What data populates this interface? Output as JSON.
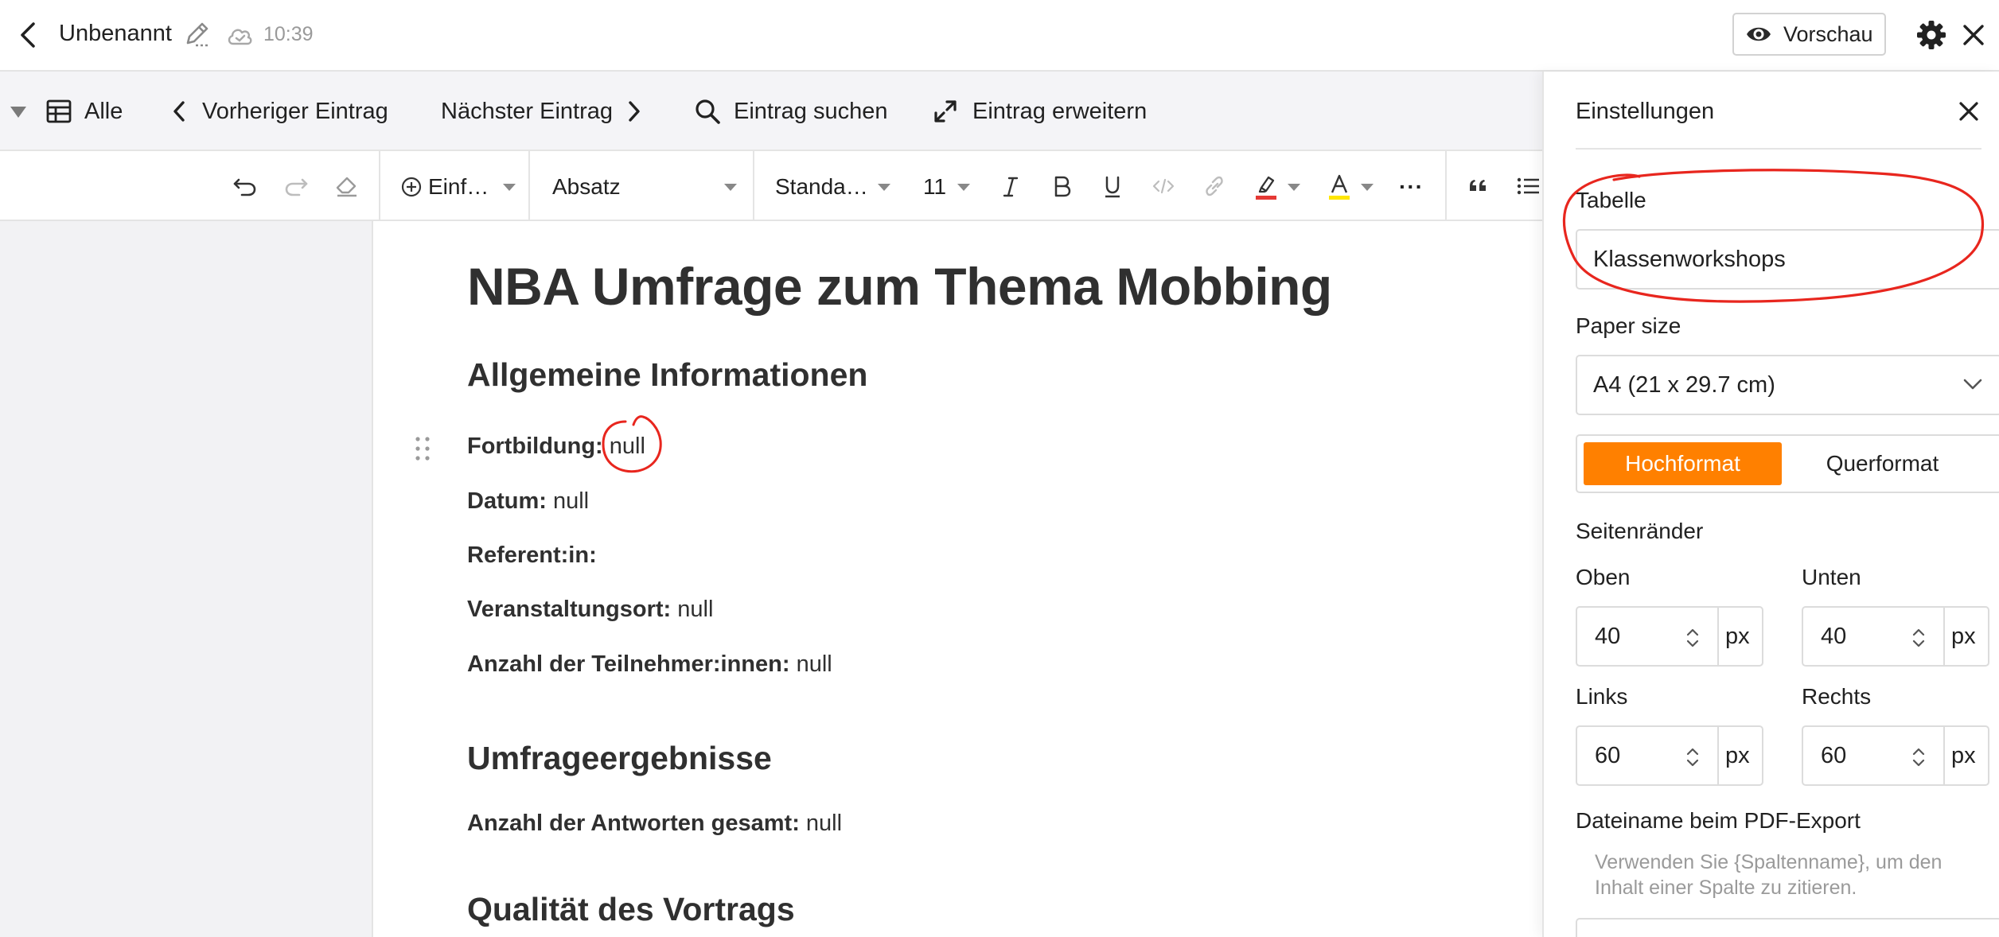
{
  "topbar": {
    "title": "Unbenannt",
    "save_time": "10:39",
    "preview_label": "Vorschau"
  },
  "navbar": {
    "view_label": "Alle",
    "prev_label": "Vorheriger Eintrag",
    "next_label": "Nächster Eintrag",
    "search_label": "Eintrag suchen",
    "expand_label": "Eintrag erweitern"
  },
  "toolbar": {
    "insert_label": "Einf…",
    "block_style": "Absatz",
    "font_family": "Standa…",
    "font_size": "11",
    "highlight_color": "#e53935",
    "text_color": "#ffe600",
    "more_label": "···"
  },
  "document": {
    "title": "NBA Umfrage zum Thema Mobbing",
    "section1_heading": "Allgemeine Informationen",
    "fields": [
      {
        "label": "Fortbildung:",
        "value": "null"
      },
      {
        "label": "Datum:",
        "value": "null"
      },
      {
        "label": "Referent:in:",
        "value": ""
      },
      {
        "label": "Veranstaltungsort:",
        "value": "null"
      },
      {
        "label": "Anzahl der Teilnehmer:innen:",
        "value": "null"
      }
    ],
    "section2_heading": "Umfrageergebnisse",
    "results_field": {
      "label": "Anzahl der Antworten gesamt:",
      "value": "null"
    },
    "section3_heading": "Qualität des Vortrags"
  },
  "settings": {
    "title": "Einstellungen",
    "table_label": "Tabelle",
    "table_value": "Klassenworkshops",
    "paper_label": "Paper size",
    "paper_value": "A4 (21 x 29.7 cm)",
    "orientation_active": "Hochformat",
    "orientation_inactive": "Querformat",
    "margins_label": "Seitenränder",
    "margins": {
      "top_label": "Oben",
      "top_value": "40",
      "bottom_label": "Unten",
      "bottom_value": "40",
      "left_label": "Links",
      "left_value": "60",
      "right_label": "Rechts",
      "right_value": "60",
      "unit": "px"
    },
    "filename_label": "Dateiname beim PDF-Export",
    "filename_help": "Verwenden Sie {Spaltenname}, um den Inhalt einer Spalte zu zitieren."
  },
  "colors": {
    "accent": "#ff8000",
    "annotation": "#e8261e"
  }
}
